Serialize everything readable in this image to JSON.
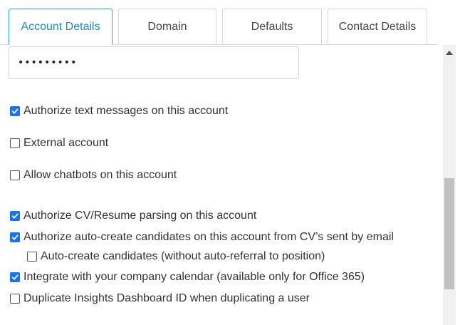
{
  "tabs": [
    {
      "label": "Account Details",
      "active": true
    },
    {
      "label": "Domain",
      "active": false
    },
    {
      "label": "Defaults",
      "active": false
    },
    {
      "label": "Contact Details",
      "active": false
    }
  ],
  "password": {
    "value": "•••••••••"
  },
  "options": [
    {
      "label": "Authorize text messages on this account",
      "checked": true
    },
    {
      "label": "External account",
      "checked": false
    },
    {
      "label": "Allow chatbots on this account",
      "checked": false
    },
    {
      "label": "Authorize CV/Resume parsing on this account",
      "checked": true
    },
    {
      "label": "Authorize auto-create candidates on this account from CV’s sent by email",
      "checked": true
    },
    {
      "label": "Auto-create candidates (without auto-referral to position)",
      "checked": false
    },
    {
      "label": "Integrate with your company calendar (available only for Office 365)",
      "checked": true
    },
    {
      "label": "Duplicate Insights Dashboard ID when duplicating a user",
      "checked": false
    }
  ],
  "colors": {
    "accent": "#1a73e8",
    "active_tab_border": "#2aa7dc",
    "active_tab_text": "#1a8ccf"
  },
  "icons": {
    "checkbox_checked": "check-icon",
    "scroll_up": "triangle-up-icon"
  }
}
